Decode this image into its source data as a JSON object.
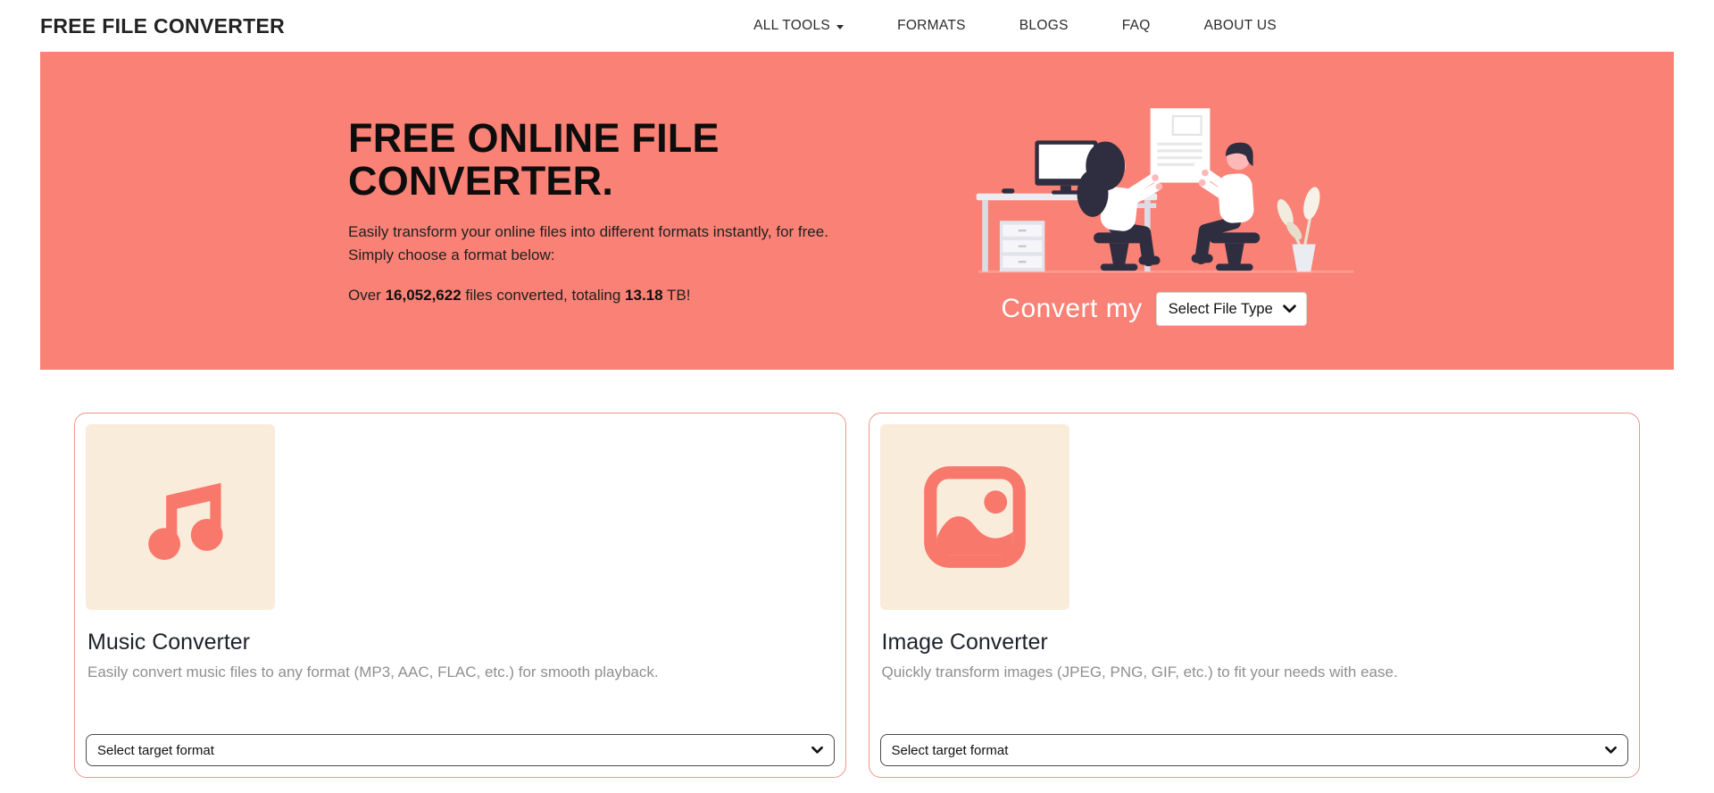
{
  "header": {
    "logo": "FREE FILE CONVERTER",
    "nav": [
      {
        "label": "ALL TOOLS",
        "has_dropdown": true
      },
      {
        "label": "FORMATS"
      },
      {
        "label": "BLOGS"
      },
      {
        "label": "FAQ"
      },
      {
        "label": "ABOUT US"
      }
    ]
  },
  "hero": {
    "title_line1": "FREE ONLINE FILE",
    "title_line2": "CONVERTER.",
    "description": "Easily transform your online files into different formats instantly, for free. Simply choose a format below:",
    "stats_prefix": "Over",
    "stats_files": "16,052,622",
    "stats_middle": "files converted, totaling",
    "stats_tb": "13.18",
    "stats_suffix": "TB!",
    "convert_label": "Convert my",
    "file_type_select_value": "Select File Type",
    "background_color": "#fa8175",
    "illustration": "two-people-exchanging-document"
  },
  "cards": [
    {
      "title": "Music Converter",
      "description": "Easily convert music files to any format (MP3, AAC, FLAC, etc.) for smooth playback.",
      "icon": "music-note-icon",
      "select_placeholder": "Select target format"
    },
    {
      "title": "Image Converter",
      "description": "Quickly transform images (JPEG, PNG, GIF, etc.) to fit your needs with ease.",
      "icon": "image-icon",
      "select_placeholder": "Select target format"
    }
  ],
  "colors": {
    "accent_salmon": "#fa8175",
    "card_border": "#f0958b",
    "icon_tile_bg": "#f9ecdb",
    "icon_coral": "#f8796c",
    "dark_navy": "#2f2e41",
    "muted_text": "#8f8f8f"
  }
}
